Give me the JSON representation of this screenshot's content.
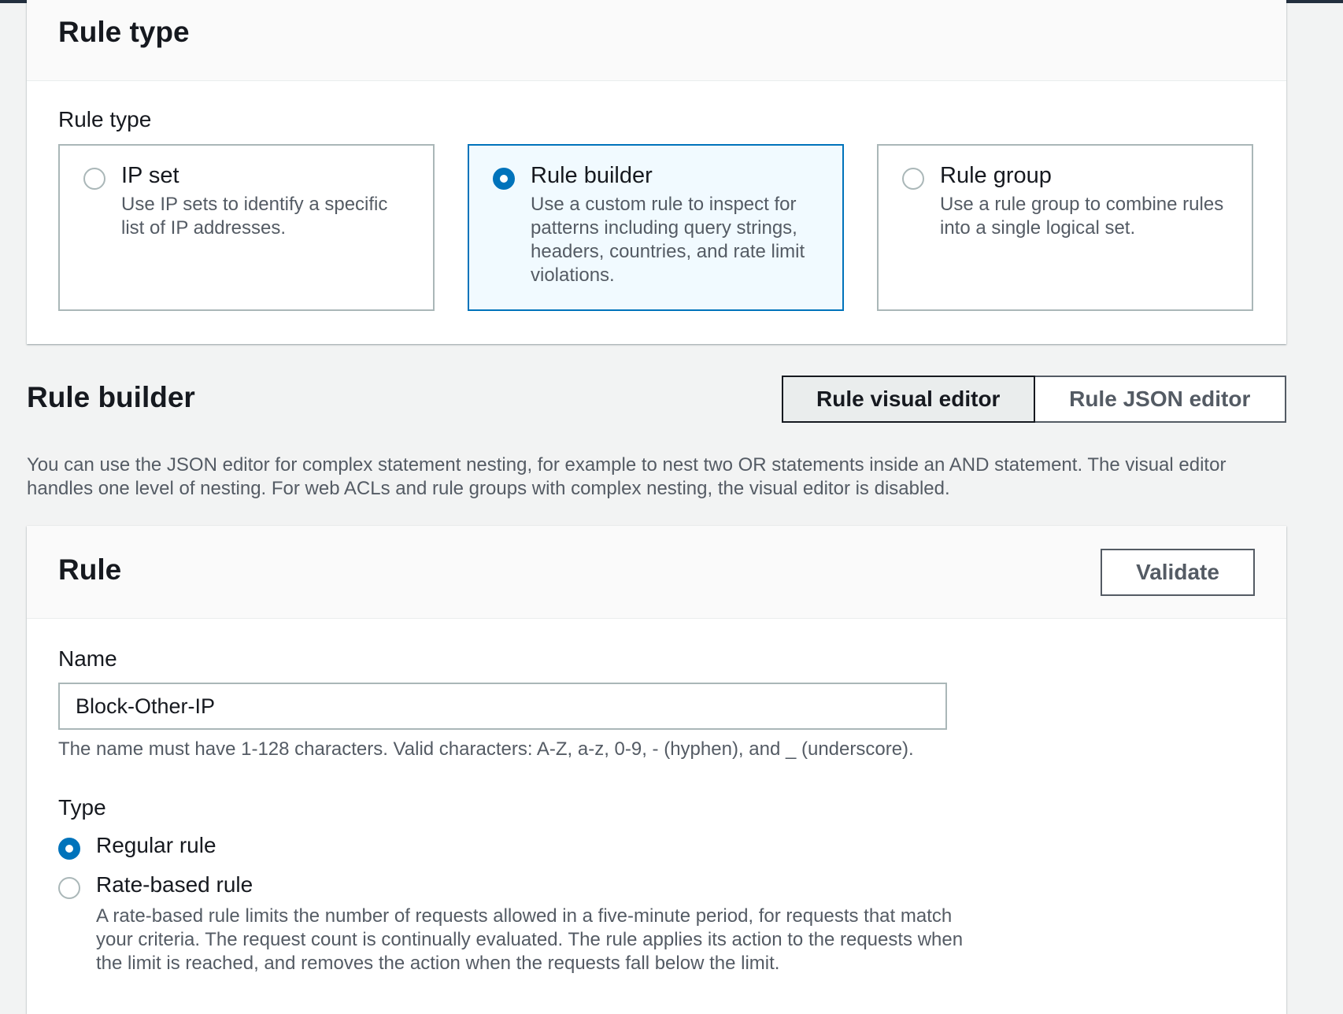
{
  "rule_type_panel": {
    "title": "Rule type",
    "field_label": "Rule type",
    "options": [
      {
        "title": "IP set",
        "description": "Use IP sets to identify a specific list of IP addresses.",
        "selected": false
      },
      {
        "title": "Rule builder",
        "description": "Use a custom rule to inspect for patterns including query strings, headers, countries, and rate limit violations.",
        "selected": true
      },
      {
        "title": "Rule group",
        "description": "Use a rule group to combine rules into a single logical set.",
        "selected": false
      }
    ]
  },
  "rule_builder": {
    "title": "Rule builder",
    "editor_tabs": [
      {
        "label": "Rule visual editor",
        "active": true
      },
      {
        "label": "Rule JSON editor",
        "active": false
      }
    ],
    "description": "You can use the JSON editor for complex statement nesting, for example to nest two OR statements inside an AND statement. The visual editor handles one level of nesting. For web ACLs and rule groups with complex nesting, the visual editor is disabled."
  },
  "rule_panel": {
    "title": "Rule",
    "validate_label": "Validate",
    "name_label": "Name",
    "name_value": "Block-Other-IP",
    "name_hint": "The name must have 1-128 characters. Valid characters: A-Z, a-z, 0-9, - (hyphen), and _ (underscore).",
    "type_label": "Type",
    "type_options": [
      {
        "label": "Regular rule",
        "selected": true
      },
      {
        "label": "Rate-based rule",
        "selected": false
      }
    ],
    "rate_based_description": "A rate-based rule limits the number of requests allowed in a five-minute period, for requests that match your criteria. The request count is continually evaluated. The rule applies its action to the requests when the limit is reached, and removes the action when the requests fall below the limit."
  },
  "colors": {
    "accent": "#0073bb",
    "page_background": "#f2f3f3",
    "secondary_text": "#545b64"
  }
}
